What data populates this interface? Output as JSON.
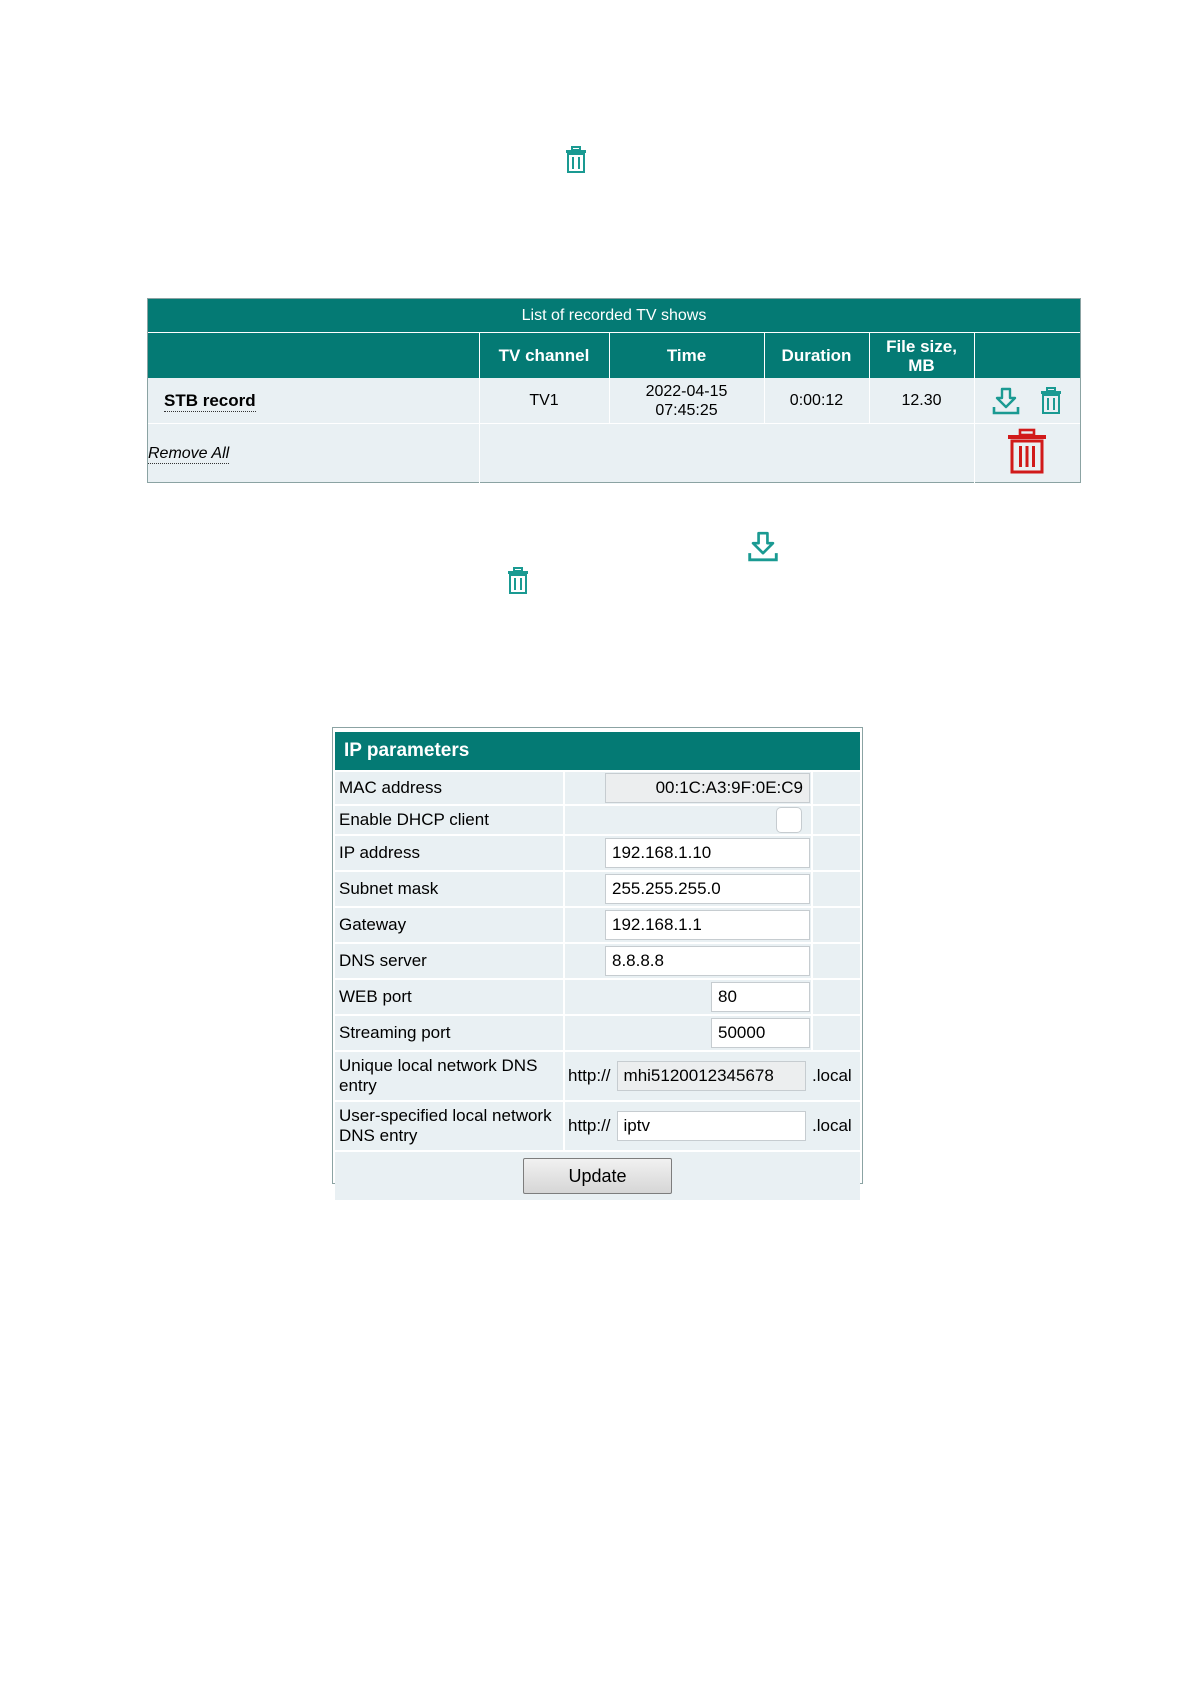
{
  "colors": {
    "header_teal": "#047a74",
    "row_bg": "#e9f0f3",
    "icon_teal": "#1a9a92",
    "delete_red": "#d11a1a"
  },
  "icons": {
    "top_trash": "trash-icon",
    "download": "download-icon",
    "delete": "trash-icon",
    "delete_all": "trash-large-red-icon"
  },
  "records": {
    "title": "List of recorded TV shows",
    "columns": [
      "",
      "TV channel",
      "Time",
      "Duration",
      "File size, MB",
      ""
    ],
    "column_time_line1": "Time",
    "column_filesize_line1": "File size,",
    "column_filesize_line2": "MB",
    "rows": [
      {
        "name": "STB record",
        "channel": "TV1",
        "date": "2022-04-15",
        "time": "07:45:25",
        "duration": "0:00:12",
        "file_size": "12.30"
      }
    ],
    "remove_all": "Remove All"
  },
  "ip": {
    "title": "IP parameters",
    "mac_label": "MAC address",
    "mac_value": "00:1C:A3:9F:0E:C9",
    "dhcp_label": "Enable DHCP client",
    "dhcp_checked": false,
    "ip_label": "IP address",
    "ip_value": "192.168.1.10",
    "mask_label": "Subnet mask",
    "mask_value": "255.255.255.0",
    "gw_label": "Gateway",
    "gw_value": "192.168.1.1",
    "dns_label": "DNS server",
    "dns_value": "8.8.8.8",
    "web_label": "WEB port",
    "web_value": "80",
    "stream_label": "Streaming port",
    "stream_value": "50000",
    "unique_label": "Unique local network DNS entry",
    "unique_prefix": "http://",
    "unique_value": "mhi5120012345678",
    "unique_suffix": ".local",
    "user_label": "User-specified local network DNS entry",
    "user_prefix": "http://",
    "user_value": "iptv",
    "user_suffix": ".local",
    "update_label": "Update"
  }
}
